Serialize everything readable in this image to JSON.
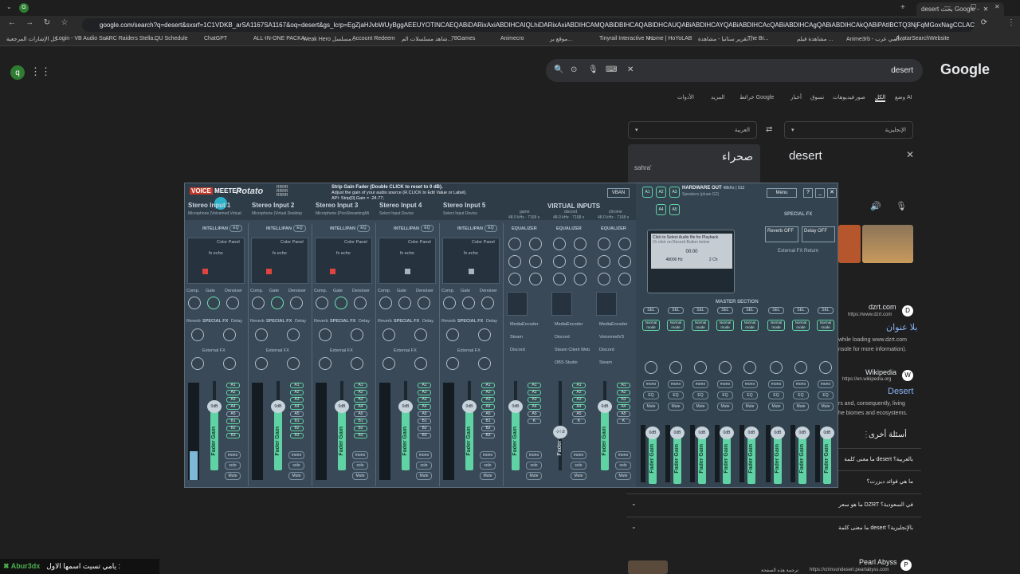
{
  "browser": {
    "tab_title": "desert بحث Google -",
    "url": "google.com/search?q=desert&sxsrf=1C1VDKB_arSA1167SA1167&oq=desert&gs_lcrp=EgZjaHJvbWUyBggAEEUYOTINCAEQABiDARixAxiABDIHCAIQLhiDARixAxiABDIHCAMQABiDBIHCAQABIDHCAUQABiABDIHCAYQABiABDIHCAcQABiABDIHCAgQABiABDIHCAkQABiPAtIBCTQ3NjFqMGoxNagCCLACAfEFusccAR34kDM&sourceid=chrome&ie=UTF-8",
    "bookmarks": [
      "كل الإشارات المرجعية",
      "Login - VB Audio So...",
      "ARC Raiders Stella...",
      "QU Schedule",
      "ChatGPT",
      "ALL-IN-ONE PACKA...",
      "Weak Hero مسلسل...",
      "Account Redeem",
      "شاهد مسلسلات الم...",
      "78Games",
      "Animecro",
      "موقع ير...",
      "Tinyrail Interactive M...",
      "Home | HoYoLAB",
      "تقرير ستاتيا - مشاهدة...",
      "The Br...",
      "مشاهدة فيلم ...",
      "Anime3rb - أنمي عرب...",
      "AvatarSearchWebsite"
    ]
  },
  "google": {
    "logo": "Google",
    "avatar": "q",
    "query": "desert",
    "tabs": [
      "وضع AI",
      "الكل",
      "صور",
      "فيديوهات",
      "تسوق",
      "أخبار",
      "خرائط Google",
      "المزيد",
      "الأدوات"
    ],
    "translate": {
      "source_lang": "الإنجليزية",
      "target_lang": "العربية",
      "source_word": "desert",
      "target_word": "صحراء",
      "translit": "sahra'"
    },
    "results": [
      {
        "site": "dzrt.com",
        "url": "https://www.dzrt.com",
        "title": "بلا عنوان",
        "snippet": "while loading www.dzrt.com\nnsole for more information)."
      },
      {
        "site": "Wikipedia",
        "url": "https://en.wikipedia.org",
        "title": "Desert",
        "snippet": "rs and, consequently, living\nhe biomes and ecosystems."
      }
    ],
    "paa_title": "أسئلة أخرى",
    "paa": [
      "ما معنى كلمة desert بالعربية؟",
      "ما هي فوائد ديزرت؟",
      "ما هو سعر DZRT في السعودية؟",
      "ما معنى كلمة desert بالإنجليزية؟"
    ],
    "bottom_result": {
      "site": "Pearl Abyss",
      "url": "https://crimsondesert.pearlabyss.com",
      "translate": "ترجمة هذه الصفحة"
    }
  },
  "overlay": {
    "name": "Abur3dx",
    "text": "يامي تسيت اسمها الاول :"
  },
  "voicemeeter": {
    "brand_voice": "VOICE",
    "brand_meeter": "MEETER",
    "edition": "Potato",
    "info": [
      "Strip Gain Fader (Double CLICK to reset to 0 dB).",
      "Adjust the gain of your audio source (R.CLICK to Edit Value or Label).",
      "API: Strip[0].Gain = -24.77;"
    ],
    "vban": "VBAN",
    "hardware_out": "HARDWARE OUT",
    "hardware_out_info": "48kHz | 512",
    "speakers": "Speakers (pluan G2)",
    "menu": "Menu",
    "outs": [
      "A1",
      "A2",
      "A3",
      "A4",
      "A5"
    ],
    "strips": [
      {
        "name": "Stereo Input 1",
        "sub": "Microphone (Voicemod Virtual",
        "fader": "0dB"
      },
      {
        "name": "Stereo Input 2",
        "sub": "Microphone (Virtual Desktop",
        "fader": "0dB"
      },
      {
        "name": "Stereo Input 3",
        "sub": "Microphone (PicoStreamingMi",
        "fader": "0dB"
      },
      {
        "name": "Stereo Input 4",
        "sub": "Select Input Device",
        "fader": "0dB"
      },
      {
        "name": "Stereo Input 5",
        "sub": "Select Input Device",
        "fader": "0dB"
      }
    ],
    "virtual_inputs": "VIRTUAL INPUTS",
    "virtual": [
      {
        "name": "game",
        "info": "48.0 kHz - 7168 s",
        "fader": "0dB"
      },
      {
        "name": "discord",
        "info": "48.0 kHz - 7168 s",
        "fader": "-24.8"
      },
      {
        "name": "chrome",
        "info": "48.0 kHz - 7168 s",
        "fader": "0dB"
      }
    ],
    "intellipan": "INTELLIPAN",
    "eq": "EQ",
    "color_panel": "Color Panel",
    "fx_echo": "fx echo",
    "knob_labels": [
      "Comp.",
      "Gate",
      "Denoiser"
    ],
    "special_fx": "SPECIAL FX",
    "external_fx": "External FX",
    "reverb": "Reverb",
    "delay": "Delay",
    "fader_label": "Fader Gain",
    "buses": [
      "A1",
      "A2",
      "A3",
      "A4",
      "A5",
      "B1",
      "B2",
      "B3"
    ],
    "mono": "mono",
    "solo": "solo",
    "mute": "Mute",
    "equalizer": "EQUALIZER",
    "apps": [
      [
        "MediaEncoder",
        "Steam",
        "Discord"
      ],
      [
        "MediaEncoder",
        "Discord",
        "Steam Client Web",
        "OBS Studio"
      ],
      [
        "MediaEncoder",
        "VoicemodV3",
        "Discord",
        "Steam"
      ]
    ],
    "player": {
      "line1": "Click to Select Audio file for Playback",
      "line2": "Or click on Record Button below",
      "time": "00:00",
      "rate": "48000 Hz",
      "ch": "2 Ch",
      "rec": "REC"
    },
    "master": "MASTER SECTION",
    "special_fx_right": "SPECIAL FX",
    "reverb_btn": "Reverb OFF",
    "delay_btn": "Delay OFF",
    "external_fx_return": "External FX Return",
    "sel": "SEL",
    "normal_mode": "Normal mode",
    "master_fader": "0dB"
  }
}
